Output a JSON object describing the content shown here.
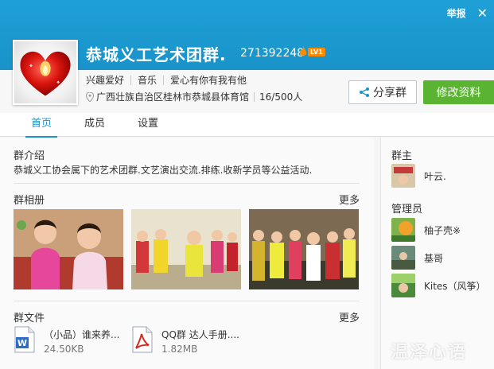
{
  "window": {
    "report_label": "举报",
    "close_icon": "close-icon"
  },
  "group": {
    "name": "恭城义工艺术团群.",
    "id": "271392248",
    "level_badge": "LV1",
    "tags": [
      "兴趣爱好",
      "音乐",
      "爱心有你有我有他"
    ],
    "location": "广西壮族自治区桂林市恭城县体育馆",
    "members_count": "16/500人"
  },
  "actions": {
    "share_label": "分享群",
    "edit_label": "修改资料"
  },
  "tabs": [
    {
      "label": "首页",
      "active": true
    },
    {
      "label": "成员",
      "active": false
    },
    {
      "label": "设置",
      "active": false
    }
  ],
  "intro": {
    "title": "群介绍",
    "text": "恭城义工协会属下的艺术团群.文艺演出交流.排练.收新学员等公益活动."
  },
  "album": {
    "title": "群相册",
    "more_label": "更多"
  },
  "files": {
    "title": "群文件",
    "more_label": "更多",
    "items": [
      {
        "name": "（小品）谁来养...",
        "size": "24.50KB",
        "icon": "word-file-icon"
      },
      {
        "name": "QQ群 达人手册....",
        "size": "1.82MB",
        "icon": "pdf-file-icon"
      }
    ]
  },
  "sidebar": {
    "owner_title": "群主",
    "owner": {
      "name": "叶云."
    },
    "admins_title": "管理员",
    "admins": [
      {
        "name": "柚子壳※"
      },
      {
        "name": "基哥"
      },
      {
        "name": "Kites（风筝）"
      }
    ]
  },
  "watermark": "温泽心语",
  "colors": {
    "header_blue": "#1993c9",
    "edit_green": "#5ab431",
    "tab_active": "#1993c9"
  }
}
